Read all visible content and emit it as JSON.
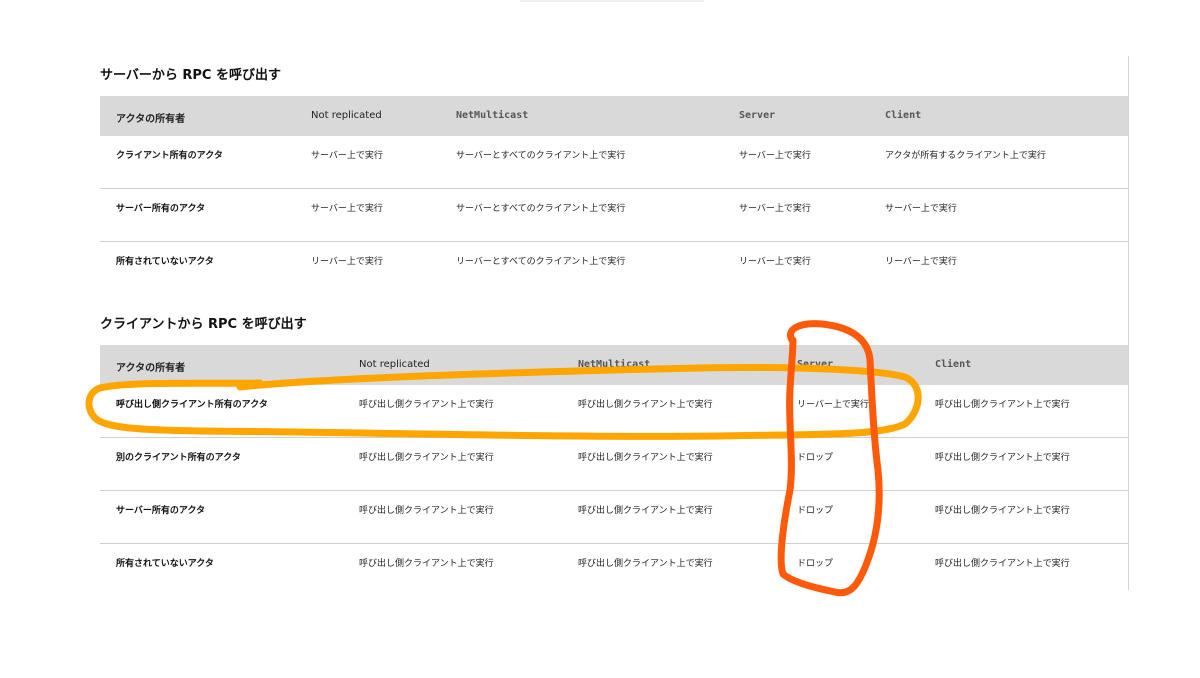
{
  "sections": [
    {
      "title": "サーバーから RPC を呼び出す",
      "headers": [
        "アクタの所有者",
        "Not replicated",
        "NetMulticast",
        "Server",
        "Client"
      ],
      "rows": [
        [
          "クライアント所有のアクタ",
          "サーバー上で実行",
          "サーバーとすべてのクライアント上で実行",
          "サーバー上で実行",
          "アクタが所有するクライアント上で実行"
        ],
        [
          "サーバー所有のアクタ",
          "サーバー上で実行",
          "サーバーとすべてのクライアント上で実行",
          "サーバー上で実行",
          "サーバー上で実行"
        ],
        [
          "所有されていないアクタ",
          "リーバー上で実行",
          "リーバーとすべてのクライアント上で実行",
          "リーバー上で実行",
          "リーバー上で実行"
        ]
      ]
    },
    {
      "title": "クライアントから RPC を呼び出す",
      "headers": [
        "アクタの所有者",
        "Not replicated",
        "NetMulticast",
        "Server",
        "Client"
      ],
      "rows": [
        [
          "呼び出し側クライアント所有のアクタ",
          "呼び出し側クライアント上で実行",
          "呼び出し側クライアント上で実行",
          "リーバー上で実行",
          "呼び出し側クライアント上で実行"
        ],
        [
          "別のクライアント所有のアクタ",
          "呼び出し側クライアント上で実行",
          "呼び出し側クライアント上で実行",
          "ドロップ",
          "呼び出し側クライアント上で実行"
        ],
        [
          "サーバー所有のアクタ",
          "呼び出し側クライアント上で実行",
          "呼び出し側クライアント上で実行",
          "ドロップ",
          "呼び出し側クライアント上で実行"
        ],
        [
          "所有されていないアクタ",
          "呼び出し側クライアント上で実行",
          "呼び出し側クライアント上で実行",
          "ドロップ",
          "呼び出し側クライアント上で実行"
        ]
      ]
    }
  ],
  "annotations": {
    "row_highlight_color": "#FFA500",
    "column_highlight_color": "#FF5A0A"
  }
}
